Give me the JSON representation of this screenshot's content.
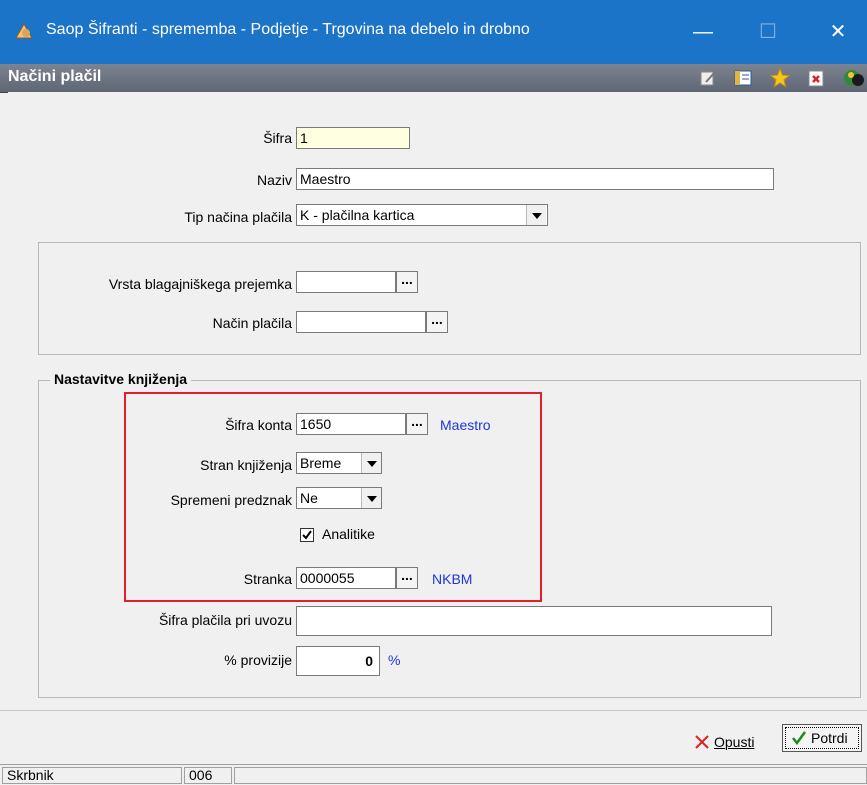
{
  "window": {
    "title": "Saop Šifranti - sprememba - Podjetje - Trgovina na debelo in drobno",
    "minimize": "—",
    "maximize": "☐",
    "close": "✕"
  },
  "header": {
    "title": "Načini plačil",
    "icons": [
      "edit-icon",
      "list-icon",
      "star-icon",
      "delete-icon",
      "exit-icon"
    ]
  },
  "form": {
    "sifra": {
      "label": "Šifra",
      "value": "1"
    },
    "naziv": {
      "label": "Naziv",
      "value": "Maestro"
    },
    "tip": {
      "label": "Tip načina plačila",
      "value": "K - plačilna kartica"
    },
    "vrsta": {
      "label": "Vrsta blagajniškega prejemka",
      "value": ""
    },
    "nacin": {
      "label": "Način plačila",
      "value": ""
    }
  },
  "booking": {
    "group_title": "Nastavitve knjiženja",
    "konto": {
      "label": "Šifra konta",
      "value": "1650",
      "desc": "Maestro"
    },
    "stran": {
      "label": "Stran knjiženja",
      "value": "Breme"
    },
    "predznak": {
      "label": "Spremeni predznak",
      "value": "Ne"
    },
    "analitike": {
      "label": "Analitike",
      "checked": true
    },
    "stranka": {
      "label": "Stranka",
      "value": "0000055",
      "desc": "NKBM"
    },
    "uvoz": {
      "label": "Šifra plačila pri uvozu",
      "value": ""
    },
    "provizija": {
      "label": "% provizije",
      "value": "0",
      "unit": "%"
    }
  },
  "footer": {
    "cancel": "Opusti",
    "confirm": "Potrdi"
  },
  "status": {
    "user": "Skrbnik",
    "code": "006"
  },
  "colors": {
    "title_bar": "#1c74c9",
    "highlight_box": "#e0202a",
    "link": "#1d36d9"
  }
}
